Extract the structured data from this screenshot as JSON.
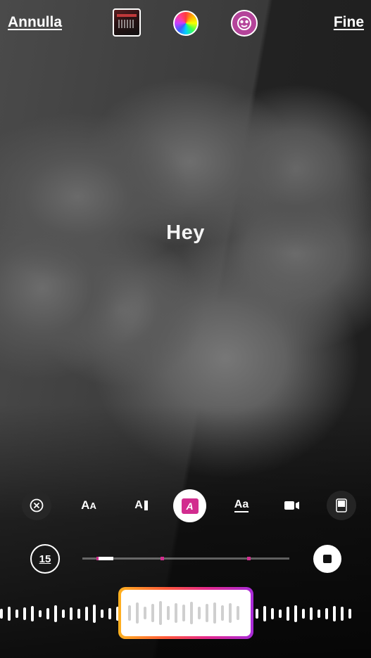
{
  "header": {
    "cancel_label": "Annulla",
    "done_label": "Fine",
    "thumbnail_icon": "album-cover-thumbnail",
    "color_icon": "color-wheel-icon",
    "effects_icon": "face-effects-icon"
  },
  "canvas": {
    "text": "Hey"
  },
  "toolbar": {
    "close_icon": "close-circle-icon",
    "size_label": "A",
    "size_label_small": "A",
    "align_label": "A",
    "style_label": "A",
    "underline_label": "Aa",
    "camera_icon": "video-camera-icon",
    "screen_icon": "phone-screen-icon"
  },
  "player": {
    "timer_label": "15",
    "progress": 0.15,
    "stop_icon": "stop-icon"
  },
  "colors": {
    "accent_pink": "#d22d8f",
    "selector_gradient": [
      "#ffb21f",
      "#ff5a3a",
      "#e52a8b",
      "#a82bd9"
    ]
  }
}
